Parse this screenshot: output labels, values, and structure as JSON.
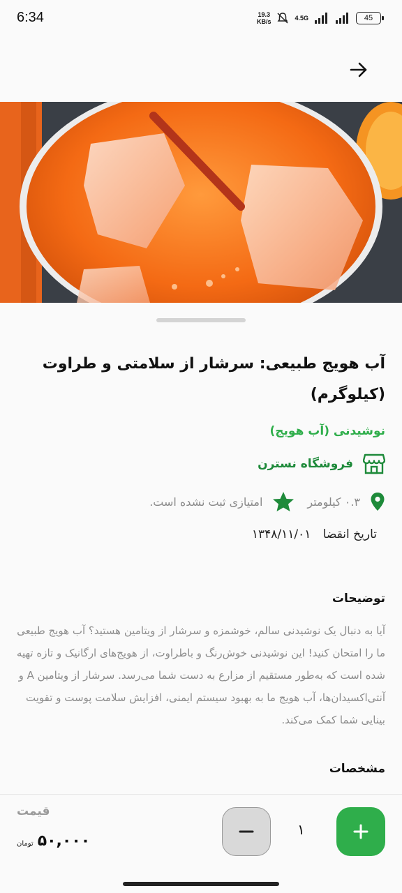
{
  "status_bar": {
    "time": "6:34",
    "net_speed_value": "19.3",
    "net_speed_unit": "KB/s",
    "network_type": "4.5G",
    "battery": "45",
    "icons": [
      "mute-notifications-icon",
      "signal-icon",
      "signal-icon",
      "battery-icon"
    ]
  },
  "app_bar": {
    "back_icon": "arrow-right-icon"
  },
  "product": {
    "title": "آب هویج طبیعی: سرشار از سلامتی و طراوت (کیلوگرم)",
    "category": "نوشیدنی (آب هویج)",
    "store": "فروشگاه نسترن",
    "distance": "۰.۳ کیلومتر",
    "rating_text": "امتیازی ثبت نشده است.",
    "expiry_label": "تاریخ انقضا",
    "expiry_date": "۱۳۴۸/۱۱/۰۱",
    "description_title": "توضیحات",
    "description": "آیا به دنبال یک نوشیدنی سالم، خوشمزه و سرشار از ویتامین هستید؟ آب هویج طبیعی ما را امتحان کنید! این نوشیدنی خوش‌رنگ و باطراوت، از هویج‌های ارگانیک و تازه تهیه شده است که به‌طور مستقیم از مزارع به دست شما می‌رسد. سرشار از ویتامین A و آنتی‌اکسیدان‌ها، آب هویج ما به بهبود سیستم ایمنی، افزایش سلامت پوست و تقویت بینایی شما کمک می‌کند.",
    "specs_title": "مشخصات"
  },
  "cart": {
    "price_label": "قیمت",
    "price_value": "۵۰,۰۰۰",
    "price_unit": "تومان",
    "quantity": "۱"
  },
  "colors": {
    "accent_green": "#2fae4b",
    "dark_green": "#1e8a3a",
    "muted_gray": "#8c8c8c"
  }
}
